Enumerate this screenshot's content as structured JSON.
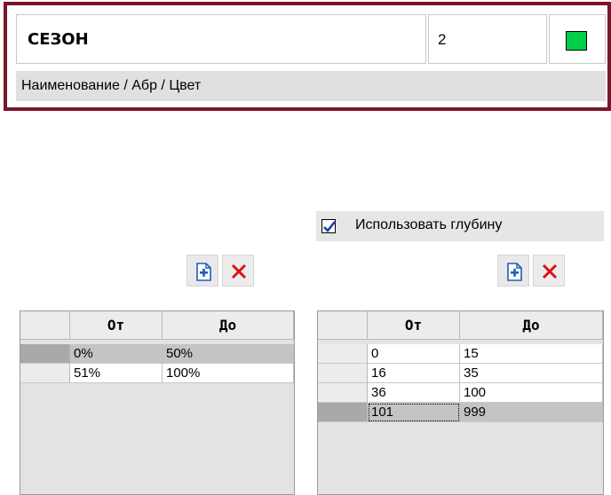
{
  "header": {
    "name_value": "СЕЗОН",
    "abbr_value": "2",
    "color_value": "#00d14a",
    "caption": "Наименование / Абр / Цвет"
  },
  "depth": {
    "label": "Использовать глубину",
    "checked": true
  },
  "toolbar_left": {
    "add_icon": "add-document-icon",
    "delete_icon": "delete-x-icon"
  },
  "toolbar_right": {
    "add_icon": "add-document-icon",
    "delete_icon": "delete-x-icon"
  },
  "left_table": {
    "columns": [
      "От",
      "До"
    ],
    "rows": [
      {
        "from": "0%",
        "to": "50%"
      },
      {
        "from": "51%",
        "to": "100%"
      }
    ]
  },
  "right_table": {
    "columns": [
      "От",
      "До"
    ],
    "rows": [
      {
        "from": "0",
        "to": "15"
      },
      {
        "from": "16",
        "to": "35"
      },
      {
        "from": "36",
        "to": "100"
      },
      {
        "from": "101",
        "to": "999"
      }
    ]
  }
}
